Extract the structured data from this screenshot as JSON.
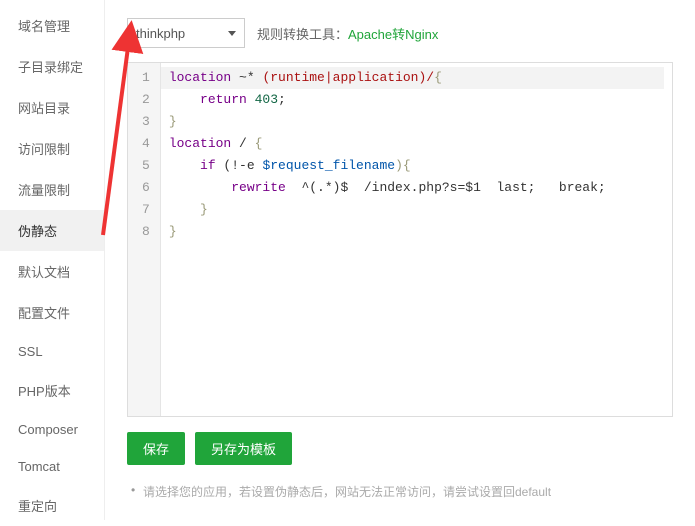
{
  "sidebar": {
    "items": [
      {
        "label": "域名管理"
      },
      {
        "label": "子目录绑定"
      },
      {
        "label": "网站目录"
      },
      {
        "label": "访问限制"
      },
      {
        "label": "流量限制"
      },
      {
        "label": "伪静态"
      },
      {
        "label": "默认文档"
      },
      {
        "label": "配置文件"
      },
      {
        "label": "SSL"
      },
      {
        "label": "PHP版本"
      },
      {
        "label": "Composer"
      },
      {
        "label": "Tomcat"
      },
      {
        "label": "重定向"
      }
    ],
    "activeIndex": 5
  },
  "toolbar": {
    "select_value": "thinkphp",
    "tool_label": "规则转换工具：",
    "tool_link": "Apache转Nginx"
  },
  "code": {
    "line1_a": "location",
    "line1_b": " ~* ",
    "line1_c": "(runtime|application)/",
    "line1_d": "{",
    "line2_a": "    return",
    "line2_b": " 403",
    "line2_c": ";",
    "line3": "}",
    "line4_a": "location",
    "line4_b": " / ",
    "line4_c": "{",
    "line5_a": "    if",
    "line5_b": " (!-e ",
    "line5_c": "$request_filename",
    "line5_d": "){",
    "line6_a": "        rewrite",
    "line6_b": "  ^(.*)$  /index.php?s=$1  last;   break;",
    "line7": "    }",
    "line8": "}"
  },
  "buttons": {
    "save": "保存",
    "save_as_template": "另存为模板"
  },
  "hint": {
    "text": "请选择您的应用，若设置伪静态后，网站无法正常访问，请尝试设置回default"
  }
}
